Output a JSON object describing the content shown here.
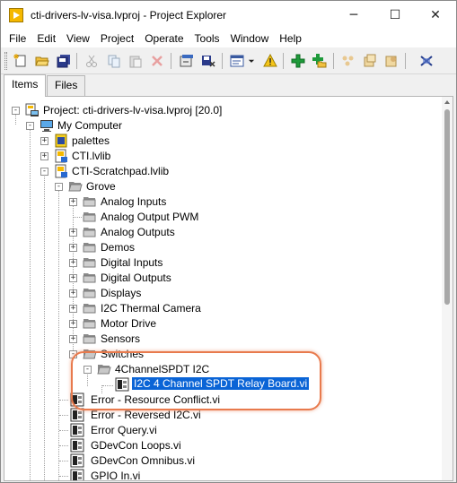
{
  "window": {
    "title": "cti-drivers-lv-visa.lvproj - Project Explorer",
    "controls": {
      "minimize": "─",
      "maximize": "☐",
      "close": "✕"
    }
  },
  "menubar": {
    "items": [
      "File",
      "Edit",
      "View",
      "Project",
      "Operate",
      "Tools",
      "Window",
      "Help"
    ]
  },
  "toolbar": {
    "buttons": [
      "new-vi-icon",
      "open-icon",
      "save-all-icon",
      "cut-icon",
      "copy-icon",
      "paste-icon",
      "delete-icon",
      "build-icon",
      "save-build-icon",
      "view-options-icon",
      "dropdown-icon",
      "warning-icon",
      "add-item-icon",
      "add-folder-icon",
      "dependencies-icon",
      "resolve-icon",
      "filter-icon",
      "overflow-icon"
    ]
  },
  "tabs": [
    {
      "label": "Items",
      "active": true
    },
    {
      "label": "Files",
      "active": false
    }
  ],
  "tree": {
    "nodes": [
      {
        "label": "Project: cti-drivers-lv-visa.lvproj [20.0]",
        "icon": "project-icon",
        "expander": "-"
      },
      {
        "label": "My Computer",
        "icon": "computer-icon",
        "expander": "-"
      },
      {
        "label": "palettes",
        "icon": "palette-library-icon",
        "expander": "+"
      },
      {
        "label": "CTI.lvlib",
        "icon": "lvlib-icon",
        "expander": "+"
      },
      {
        "label": "CTI-Scratchpad.lvlib",
        "icon": "lvlib-icon",
        "expander": "-"
      },
      {
        "label": "Grove",
        "icon": "folder-icon",
        "expander": "-"
      },
      {
        "label": "Analog Inputs",
        "icon": "folder-icon",
        "expander": "+"
      },
      {
        "label": "Analog Output PWM",
        "icon": "folder-icon",
        "expander": ""
      },
      {
        "label": "Analog Outputs",
        "icon": "folder-icon",
        "expander": "+"
      },
      {
        "label": "Demos",
        "icon": "folder-icon",
        "expander": "+"
      },
      {
        "label": "Digital Inputs",
        "icon": "folder-icon",
        "expander": "+"
      },
      {
        "label": "Digital Outputs",
        "icon": "folder-icon",
        "expander": "+"
      },
      {
        "label": "Displays",
        "icon": "folder-icon",
        "expander": "+"
      },
      {
        "label": "I2C Thermal Camera",
        "icon": "folder-icon",
        "expander": "+"
      },
      {
        "label": "Motor Drive",
        "icon": "folder-icon",
        "expander": "+"
      },
      {
        "label": "Sensors",
        "icon": "folder-icon",
        "expander": "+"
      },
      {
        "label": "Switches",
        "icon": "folder-icon",
        "expander": "-"
      },
      {
        "label": "4ChannelSPDT I2C",
        "icon": "folder-icon",
        "expander": "-"
      },
      {
        "label": "I2C 4 Channel SPDT Relay Board.vi",
        "icon": "vi-icon",
        "expander": "",
        "selected": true
      },
      {
        "label": "Error - Resource Conflict.vi",
        "icon": "vi-icon",
        "expander": ""
      },
      {
        "label": "Error - Reversed I2C.vi",
        "icon": "vi-icon",
        "expander": ""
      },
      {
        "label": "Error Query.vi",
        "icon": "vi-icon",
        "expander": ""
      },
      {
        "label": "GDevCon Loops.vi",
        "icon": "vi-icon",
        "expander": ""
      },
      {
        "label": "GDevCon Omnibus.vi",
        "icon": "vi-icon",
        "expander": ""
      },
      {
        "label": "GPIO In.vi",
        "icon": "vi-icon",
        "expander": ""
      }
    ]
  },
  "colors": {
    "selection": "#0a64d6",
    "highlight_ring": "#e87a4d",
    "folder": "#9a9a9a",
    "app_icon": "#f5b800"
  }
}
